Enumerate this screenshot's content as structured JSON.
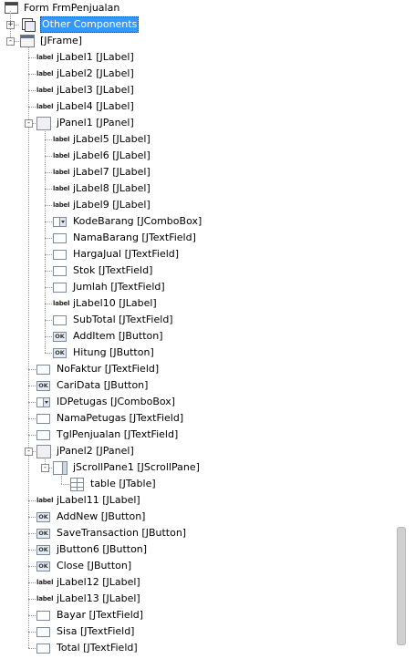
{
  "root": {
    "label": "Form FrmPenjualan",
    "icon": "form-icon"
  },
  "nodes": [
    {
      "label": "Other Components",
      "icon": "other-components-icon",
      "level": 1,
      "toggle": "+",
      "selected": true
    },
    {
      "label": "[JFrame]",
      "icon": "jframe-icon",
      "level": 1,
      "toggle": "-"
    },
    {
      "label": "jLabel1 [JLabel]",
      "icon": "label",
      "level": 2
    },
    {
      "label": "jLabel2 [JLabel]",
      "icon": "label",
      "level": 2
    },
    {
      "label": "jLabel3 [JLabel]",
      "icon": "label",
      "level": 2
    },
    {
      "label": "jLabel4 [JLabel]",
      "icon": "label",
      "level": 2
    },
    {
      "label": "jPanel1 [JPanel]",
      "icon": "panel",
      "level": 2,
      "toggle": "-"
    },
    {
      "label": "jLabel5 [JLabel]",
      "icon": "label",
      "level": 3
    },
    {
      "label": "jLabel6 [JLabel]",
      "icon": "label",
      "level": 3
    },
    {
      "label": "jLabel7 [JLabel]",
      "icon": "label",
      "level": 3
    },
    {
      "label": "jLabel8 [JLabel]",
      "icon": "label",
      "level": 3
    },
    {
      "label": "jLabel9 [JLabel]",
      "icon": "label",
      "level": 3
    },
    {
      "label": "KodeBarang [JComboBox]",
      "icon": "combo",
      "level": 3
    },
    {
      "label": "NamaBarang [JTextField]",
      "icon": "field",
      "level": 3
    },
    {
      "label": "HargaJual [JTextField]",
      "icon": "field",
      "level": 3
    },
    {
      "label": "Stok [JTextField]",
      "icon": "field",
      "level": 3
    },
    {
      "label": "Jumlah [JTextField]",
      "icon": "field",
      "level": 3
    },
    {
      "label": "jLabel10 [JLabel]",
      "icon": "label",
      "level": 3
    },
    {
      "label": "SubTotal [JTextField]",
      "icon": "field",
      "level": 3
    },
    {
      "label": "AddItem [JButton]",
      "icon": "button",
      "level": 3
    },
    {
      "label": "Hitung [JButton]",
      "icon": "button",
      "level": 3
    },
    {
      "label": "NoFaktur [JTextField]",
      "icon": "field",
      "level": 2
    },
    {
      "label": "CariData [JButton]",
      "icon": "button",
      "level": 2
    },
    {
      "label": "IDPetugas [JComboBox]",
      "icon": "combo",
      "level": 2
    },
    {
      "label": "NamaPetugas [JTextField]",
      "icon": "field",
      "level": 2
    },
    {
      "label": "TglPenjualan [JTextField]",
      "icon": "field",
      "level": 2
    },
    {
      "label": "jPanel2 [JPanel]",
      "icon": "panel",
      "level": 2,
      "toggle": "-"
    },
    {
      "label": "jScrollPane1 [JScrollPane]",
      "icon": "scroll",
      "level": 3,
      "toggle": "-"
    },
    {
      "label": "table [JTable]",
      "icon": "table",
      "level": 4
    },
    {
      "label": "jLabel11 [JLabel]",
      "icon": "label",
      "level": 2
    },
    {
      "label": "AddNew [JButton]",
      "icon": "button",
      "level": 2
    },
    {
      "label": "SaveTransaction [JButton]",
      "icon": "button",
      "level": 2
    },
    {
      "label": "jButton6 [JButton]",
      "icon": "button",
      "level": 2
    },
    {
      "label": "Close [JButton]",
      "icon": "button",
      "level": 2
    },
    {
      "label": "jLabel12 [JLabel]",
      "icon": "label",
      "level": 2
    },
    {
      "label": "jLabel13 [JLabel]",
      "icon": "label",
      "level": 2
    },
    {
      "label": "Bayar [JTextField]",
      "icon": "field",
      "level": 2
    },
    {
      "label": "Sisa [JTextField]",
      "icon": "field",
      "level": 2
    },
    {
      "label": "Total [JTextField]",
      "icon": "field",
      "level": 2
    }
  ],
  "icon_text": {
    "label": "label",
    "button": "OK"
  },
  "colors": {
    "selection": "#3399ff",
    "tree_lines": "#9a9a9a"
  }
}
